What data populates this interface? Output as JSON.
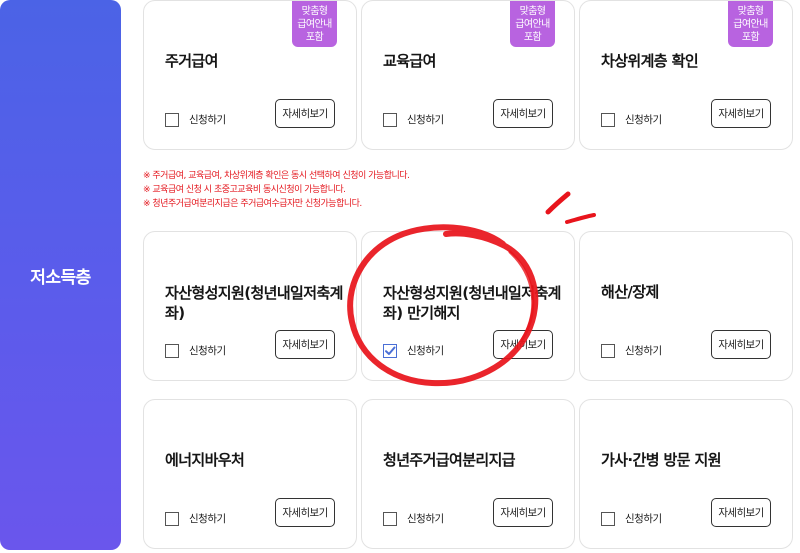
{
  "sidebar": {
    "label": "저소득층"
  },
  "cards": [
    {
      "title": "주거급여",
      "tag": [
        "맞춤형",
        "급여안내",
        "포함"
      ],
      "checkbox_label": "신청하기",
      "checked": false,
      "detail_label": "자세히보기"
    },
    {
      "title": "교육급여",
      "tag": [
        "맞춤형",
        "급여안내",
        "포함"
      ],
      "checkbox_label": "신청하기",
      "checked": false,
      "detail_label": "자세히보기"
    },
    {
      "title": "차상위계층 확인",
      "tag": [
        "맞춤형",
        "급여안내",
        "포함"
      ],
      "checkbox_label": "신청하기",
      "checked": false,
      "detail_label": "자세히보기"
    },
    {
      "title": "자산형성지원(청년내일저축계좌)",
      "checkbox_label": "신청하기",
      "checked": false,
      "detail_label": "자세히보기"
    },
    {
      "title": "자산형성지원(청년내일저축계좌) 만기해지",
      "checkbox_label": "신청하기",
      "checked": true,
      "detail_label": "자세히보기"
    },
    {
      "title": "해산/장제",
      "checkbox_label": "신청하기",
      "checked": false,
      "detail_label": "자세히보기"
    },
    {
      "title": "에너지바우처",
      "checkbox_label": "신청하기",
      "checked": false,
      "detail_label": "자세히보기"
    },
    {
      "title": "청년주거급여분리지급",
      "checkbox_label": "신청하기",
      "checked": false,
      "detail_label": "자세히보기"
    },
    {
      "title": "가사·간병 방문 지원",
      "checkbox_label": "신청하기",
      "checked": false,
      "detail_label": "자세히보기"
    }
  ],
  "notices": [
    "※ 주거급여, 교육급여, 차상위계층 확인은 동시 선택하여 신청이 가능합니다.",
    "※ 교육급여 신청 시 초중고교육비 동시신청이 가능합니다.",
    "※ 청년주거급여분리지급은 주거급여수급자만 신청가능합니다."
  ],
  "colors": {
    "sidebar_top": "#4b63e6",
    "sidebar_bottom": "#6a56ec",
    "tag": "#b863e0",
    "notice": "#e4171e",
    "annotation": "#e8141c",
    "check": "#4a6fd6"
  }
}
